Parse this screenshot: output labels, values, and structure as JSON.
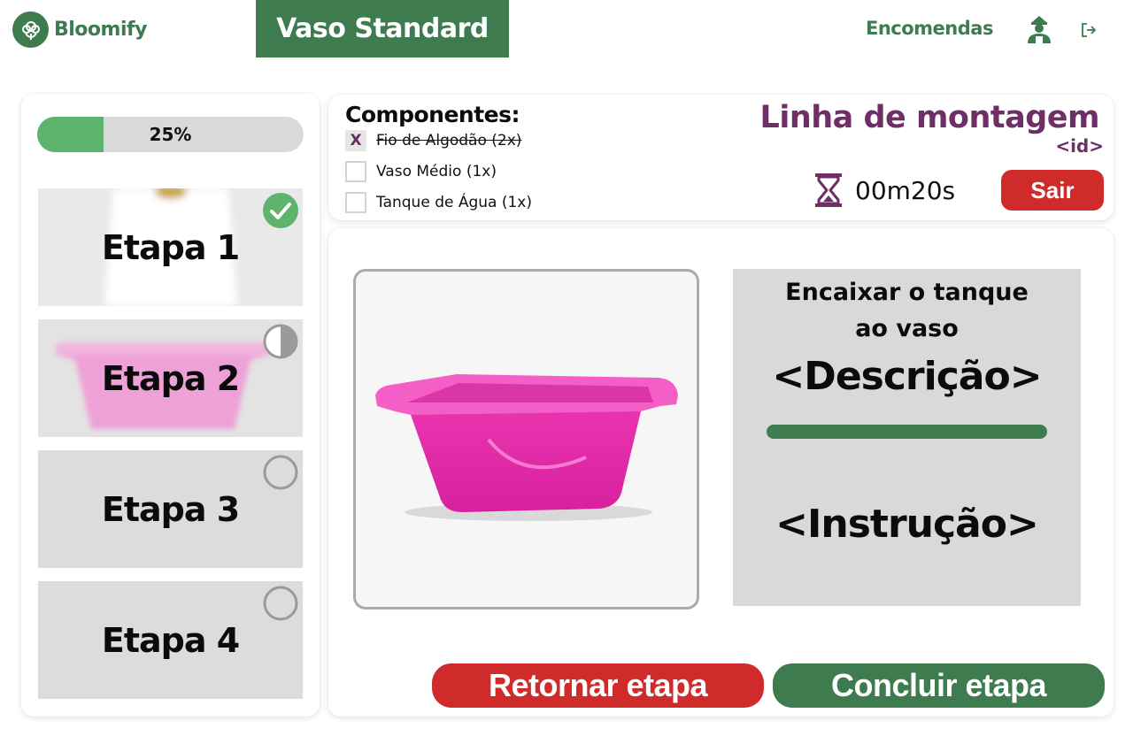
{
  "header": {
    "brand": "Bloomify",
    "product_title": "Vaso Standard",
    "nav_orders": "Encomendas"
  },
  "progress": {
    "label": "25%",
    "value": 0.25
  },
  "steps": [
    {
      "label": "Etapa 1",
      "status": "completed",
      "status_icon": "check-circle-icon"
    },
    {
      "label": "Etapa 2",
      "status": "in-progress",
      "status_icon": "half-circle-icon"
    },
    {
      "label": "Etapa 3",
      "status": "pending",
      "status_icon": "empty-circle-icon"
    },
    {
      "label": "Etapa 4",
      "status": "pending",
      "status_icon": "empty-circle-icon"
    }
  ],
  "components": {
    "title": "Componentes:",
    "items": [
      {
        "label": "Fio de Algodão (2x)",
        "checked": true,
        "mark": "X"
      },
      {
        "label": "Vaso Médio (1x)",
        "checked": false
      },
      {
        "label": "Tanque de Água (1x)",
        "checked": false
      }
    ]
  },
  "line": {
    "title": "Linha de montagem",
    "id": "<id>"
  },
  "timer": {
    "value": "00m20s"
  },
  "exit_label": "Sair",
  "instruction_panel": {
    "step_title": "Encaixar o tanque ao vaso",
    "description": "<Descrição>",
    "instruction": "<Instrução>"
  },
  "actions": {
    "back_label": "Retornar etapa",
    "done_label": "Concluir etapa"
  },
  "colors": {
    "brand_green": "#3e7b4f",
    "progress_green": "#5fb46d",
    "accent_purple": "#6e2f66",
    "danger_red": "#cf2b2b"
  }
}
